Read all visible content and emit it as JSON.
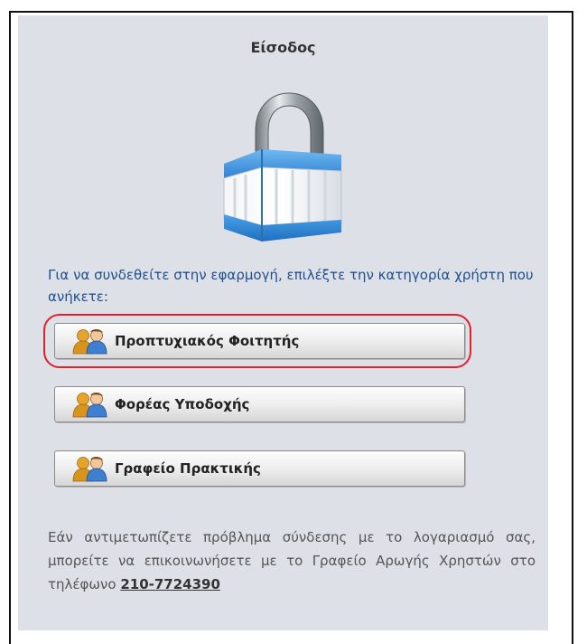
{
  "login": {
    "title": "Είσοδος",
    "prompt": "Για να συνδεθείτε στην εφαρμογή, επιλέξτε την κατηγορία χρήστη που ανήκετε:",
    "buttons": [
      {
        "label": "Προπτυχιακός Φοιτητής",
        "icon": "users-icon",
        "highlighted": true
      },
      {
        "label": "Φορέας Υποδοχής",
        "icon": "users-icon",
        "highlighted": false
      },
      {
        "label": "Γραφείο Πρακτικής",
        "icon": "users-icon",
        "highlighted": false
      }
    ],
    "help_text": "Εάν αντιμετωπίζετε πρόβλημα σύνδεσης με το λογαριασμό σας, μπορείτε να επικοινωνήσετε με το Γραφείο Αρωγής Χρηστών στο τηλέφωνο",
    "help_phone": "210-7724390"
  },
  "colors": {
    "panel_bg": "#dde1e7",
    "prompt_text": "#1f4f8f",
    "highlight": "#e0212b",
    "lock_blue": "#3b8fd8"
  },
  "icons": {
    "main": "padlock-icon"
  }
}
